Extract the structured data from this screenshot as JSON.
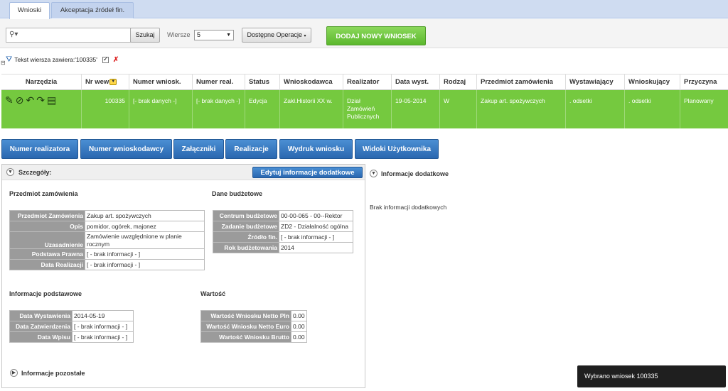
{
  "tabs": [
    {
      "label": "Wnioski"
    },
    {
      "label": "Akceptacja źródeł fin."
    }
  ],
  "toolbar": {
    "search_value": "",
    "search_button": "Szukaj",
    "rows_label": "Wiersze",
    "rows_value": "5",
    "operations_button": "Dostępne Operacje",
    "add_button": "DODAJ NOWY WNIOSEK"
  },
  "filter": {
    "text": "Tekst wiersza zawiera:'100335'"
  },
  "table": {
    "headers": [
      "Narzędzia",
      "Nr wew",
      "Numer wniosk.",
      "Numer real.",
      "Status",
      "Wnioskodawca",
      "Realizator",
      "Data wyst.",
      "Rodzaj",
      "Przedmiot zamówienia",
      "Wystawiający",
      "Wnioskujący",
      "Przyczyna"
    ],
    "row": {
      "nr_wew": "100335",
      "numer_wniosku": "[- brak danych -]",
      "numer_real": "[- brak danych -]",
      "status": "Edycja",
      "wnioskodawca": "Zakł.Historii XX w.",
      "realizator": "Dział Zamówień Publicznych",
      "data_wyst": "19-05-2014",
      "rodzaj": "W",
      "przedmiot": "Zakup art. spożywczych",
      "wystawiajacy": ". odsetki",
      "wnioskujacy": ". odsetki",
      "przyczyna": "Planowany"
    }
  },
  "actions": [
    "Numer realizatora",
    "Numer wnioskodawcy",
    "Załączniki",
    "Realizacje",
    "Wydruk wniosku",
    "Widoki Użytkownika"
  ],
  "details": {
    "title": "Szczegóły:",
    "edit_button": "Edytuj informacje dodatkowe",
    "przedmiot_section": "Przedmiot zamówienia",
    "przedmiot_rows": [
      {
        "k": "Przedmiot Zamówienia",
        "v": "Zakup art. spożywczych"
      },
      {
        "k": "Opis",
        "v": "pomidor, ogórek, majonez"
      },
      {
        "k": "Uzasadnienie",
        "v": "Zamówienie uwzględnione w planie rocznym"
      },
      {
        "k": "Podstawa Prawna",
        "v": "[ - brak informacji - ]"
      },
      {
        "k": "Data Realizacji",
        "v": "[ - brak informacji - ]"
      }
    ],
    "budzet_section": "Dane budżetowe",
    "budzet_rows": [
      {
        "k": "Centrum budżetowe",
        "v": "00-00-065 - 00--Rektor"
      },
      {
        "k": "Zadanie budżetowe",
        "v": "ZD2 - Działalność ogólna"
      },
      {
        "k": "Źródło fin.",
        "v": "[ - brak informacji - ]"
      },
      {
        "k": "Rok budżetowania",
        "v": "2014"
      }
    ],
    "podstawowe_section": "Informacje podstawowe",
    "podstawowe_rows": [
      {
        "k": "Data Wystawienia",
        "v": "2014-05-19"
      },
      {
        "k": "Data Zatwierdzenia",
        "v": "[ - brak informacji - ]"
      },
      {
        "k": "Data Wpisu",
        "v": "[ - brak informacji - ]"
      }
    ],
    "wartosc_section": "Wartość",
    "wartosc_rows": [
      {
        "k": "Wartość Wniosku Netto Pln",
        "v": "0.00"
      },
      {
        "k": "Wartość Wniosku Netto Euro",
        "v": "0.00"
      },
      {
        "k": "Wartość Wniosku Brutto",
        "v": "0.00"
      }
    ],
    "pozostale": "Informacje pozostałe"
  },
  "extra": {
    "title": "Informacje dodatkowe",
    "empty_text": "Brak informacji dodatkowych"
  },
  "toast": "Wybrano wniosek 100335"
}
